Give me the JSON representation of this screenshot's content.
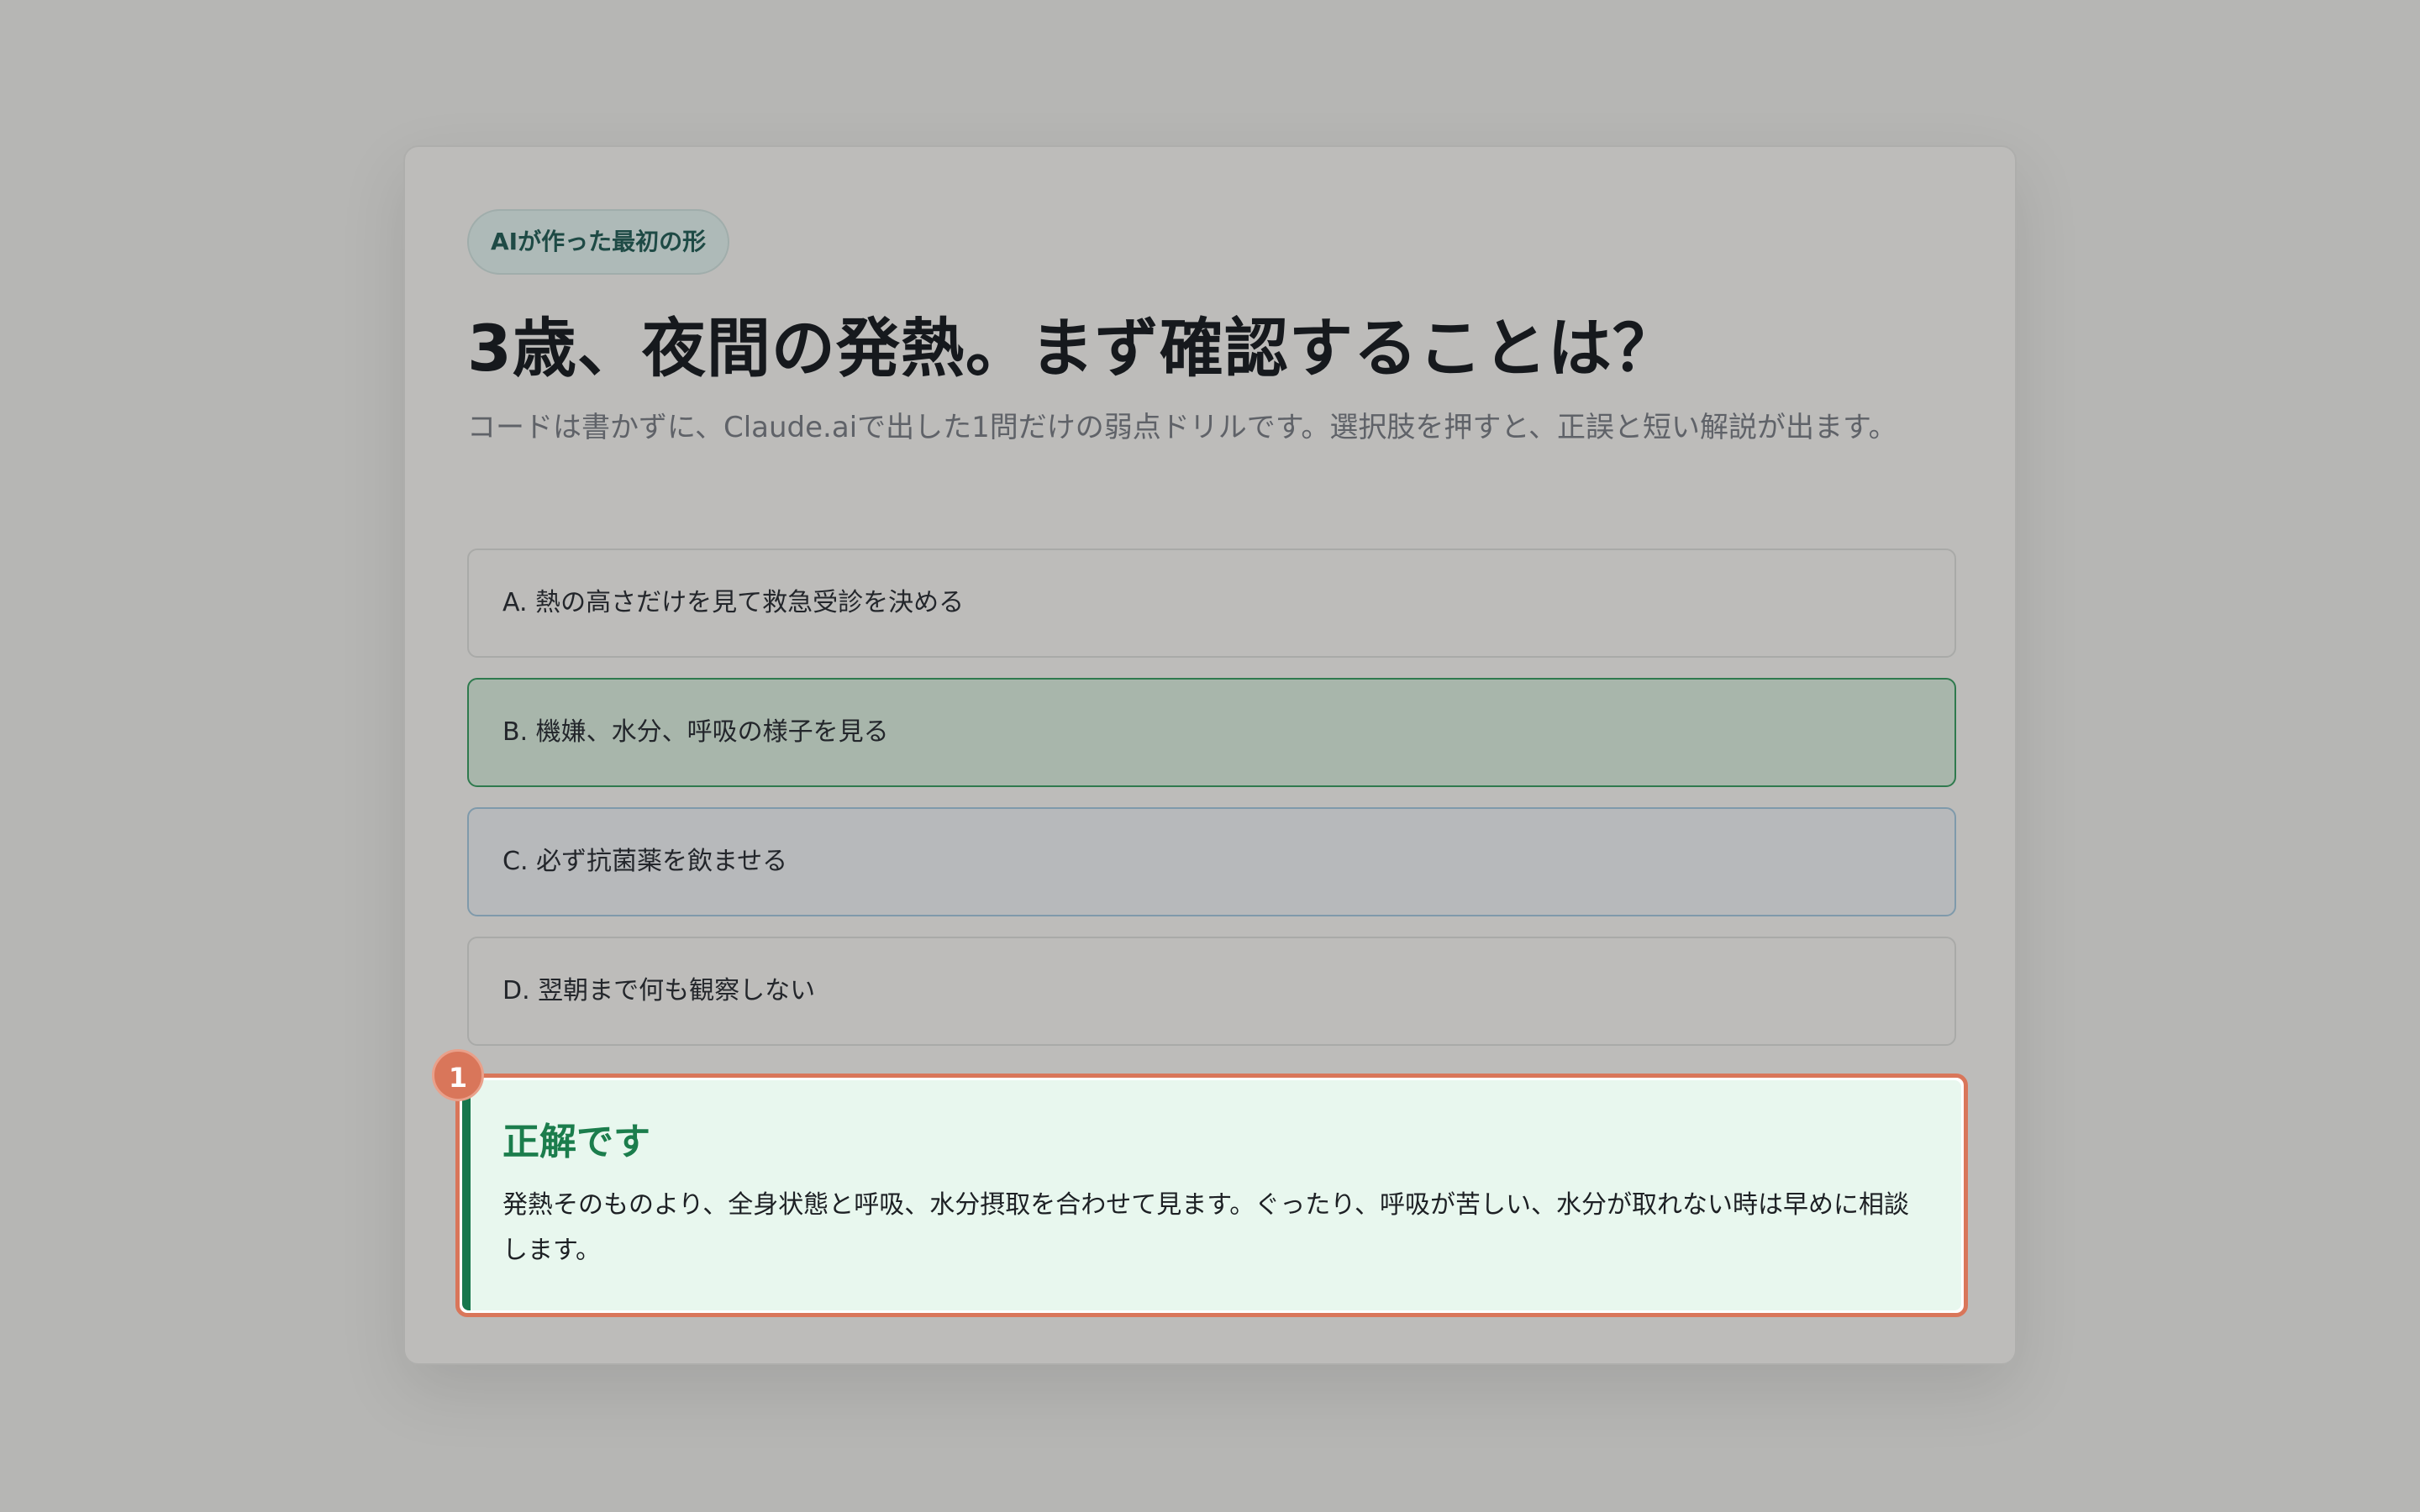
{
  "badge": "AIが作った最初の形",
  "question": "3歳、夜間の発熱。まず確認することは？",
  "description": "コードは書かずに、Claude.aiで出した1問だけの弱点ドリルです。選択肢を押すと、正誤と短い解説が出ます。",
  "options": [
    {
      "label": "A. 熱の高さだけを見て救急受診を決める",
      "state": "default"
    },
    {
      "label": "B. 機嫌、水分、呼吸の様子を見る",
      "state": "correct"
    },
    {
      "label": "C. 必ず抗菌薬を飲ませる",
      "state": "hover"
    },
    {
      "label": "D. 翌朝まで何も観察しない",
      "state": "default"
    }
  ],
  "feedback": {
    "title": "正解です",
    "text": "発熱そのものより、全身状態と呼吸、水分摂取を合わせて見ます。ぐったり、呼吸が苦しい、水分が取れない時は早めに相談します。"
  },
  "marker": "1",
  "colors": {
    "correct": "#17774d",
    "highlight": "#d9765a",
    "badge_text": "#1e4a45"
  }
}
